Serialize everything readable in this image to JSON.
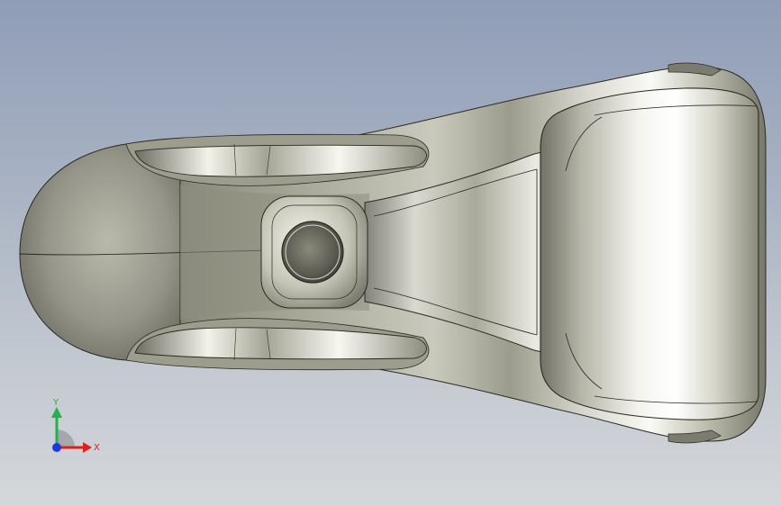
{
  "viewport": {
    "background_top": "#8f9db7",
    "background_bottom": "#d4d7da"
  },
  "model": {
    "description_name": "cad-part-bracket",
    "body_color": "#a4a493",
    "highlight_color": "#f2f2ea",
    "edge_color": "#2a2a24"
  },
  "triad": {
    "x_label": "X",
    "y_label": "Y",
    "x_color": "#e0201a",
    "y_color": "#22b14c",
    "z_color": "#1a3adf"
  }
}
